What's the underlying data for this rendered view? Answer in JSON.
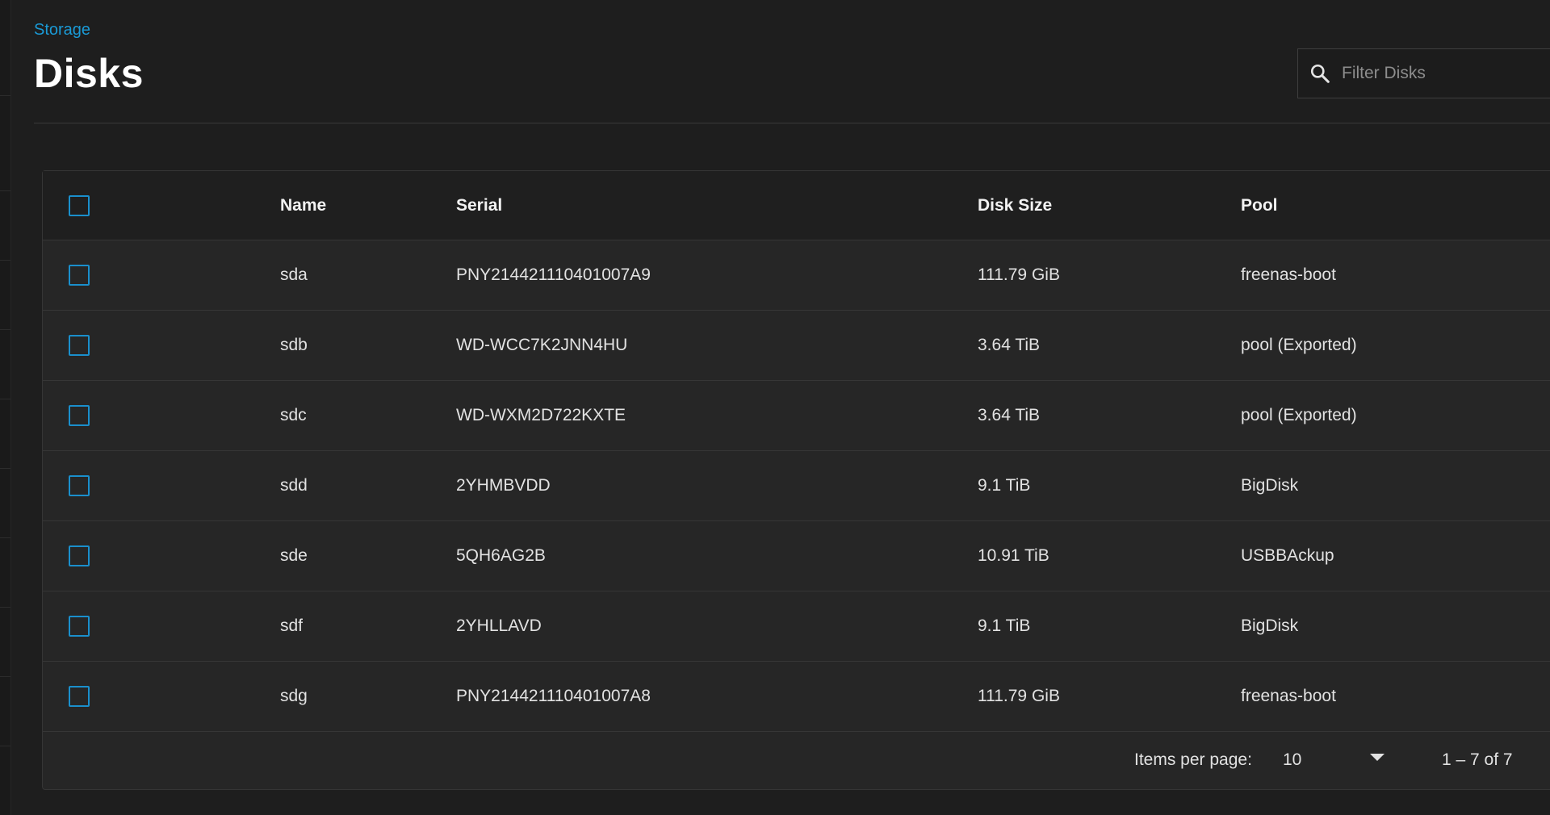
{
  "breadcrumb": {
    "label": "Storage"
  },
  "page": {
    "title": "Disks"
  },
  "search": {
    "placeholder": "Filter Disks",
    "value": ""
  },
  "table": {
    "columns": [
      "Name",
      "Serial",
      "Disk Size",
      "Pool"
    ],
    "rows": [
      {
        "name": "sda",
        "serial": "PNY214421110401007A9",
        "size": "111.79 GiB",
        "pool": "freenas-boot"
      },
      {
        "name": "sdb",
        "serial": "WD-WCC7K2JNN4HU",
        "size": "3.64 TiB",
        "pool": "pool (Exported)"
      },
      {
        "name": "sdc",
        "serial": "WD-WXM2D722KXTE",
        "size": "3.64 TiB",
        "pool": "pool (Exported)"
      },
      {
        "name": "sdd",
        "serial": "2YHMBVDD",
        "size": "9.1 TiB",
        "pool": "BigDisk"
      },
      {
        "name": "sde",
        "serial": "5QH6AG2B",
        "size": "10.91 TiB",
        "pool": "USBBAckup"
      },
      {
        "name": "sdf",
        "serial": "2YHLLAVD",
        "size": "9.1 TiB",
        "pool": "BigDisk"
      },
      {
        "name": "sdg",
        "serial": "PNY214421110401007A8",
        "size": "111.79 GiB",
        "pool": "freenas-boot"
      }
    ]
  },
  "paginator": {
    "items_per_page_label": "Items per page:",
    "page_size": "10",
    "range_label": "1 – 7 of 7"
  },
  "icons": {
    "search": "search-icon",
    "dropdown": "chevron-down-icon",
    "checkbox": "checkbox-unchecked"
  },
  "colors": {
    "accent": "#1a9ad6",
    "checkbox": "#1a8fcc",
    "background": "#1e1e1e",
    "card": "#262626"
  }
}
